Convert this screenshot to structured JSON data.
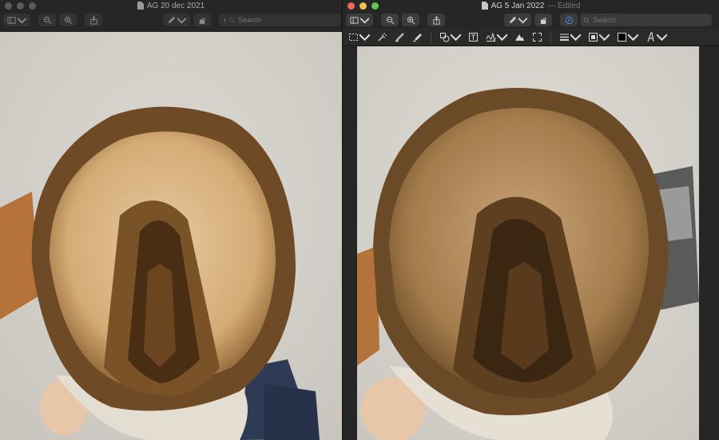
{
  "left_window": {
    "title": "AG 20 dec 2021",
    "search_placeholder": "Search"
  },
  "right_window": {
    "title": "AG 5 Jan 2022",
    "edited_suffix": "— Edited",
    "search_placeholder": "Search"
  },
  "icons": {
    "sidebar": "sidebar-icon",
    "zoom_out": "zoom-out-icon",
    "zoom_in": "zoom-in-icon",
    "share": "share-icon",
    "markup_pen": "pen-icon",
    "rotate": "rotate-icon",
    "markup_toggle": "markup-icon",
    "search": "search-icon"
  },
  "colors": {
    "accent": "#3d8ef7",
    "traffic_red": "#ed6a5e",
    "traffic_yellow": "#f5bf4f",
    "traffic_green": "#62c554"
  }
}
